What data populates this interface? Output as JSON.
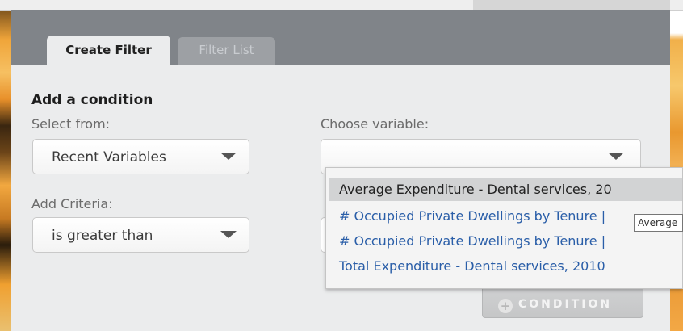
{
  "tabs": {
    "create_filter": "Create Filter",
    "filter_list": "Filter List"
  },
  "form": {
    "title": "Add a condition",
    "select_from_label": "Select from:",
    "select_from_value": "Recent Variables",
    "choose_variable_label": "Choose variable:",
    "choose_variable_value": "",
    "add_criteria_label": "Add Criteria:",
    "criteria_value": "is greater than",
    "condition_button": "CONDITION"
  },
  "suggestions": [
    {
      "label": "Average Expenditure - Dental services, 20",
      "selected": true
    },
    {
      "label": "# Occupied Private Dwellings by Tenure |",
      "selected": false
    },
    {
      "label": "# Occupied Private Dwellings by Tenure |",
      "selected": false
    },
    {
      "label": "Total Expenditure - Dental services, 2010",
      "selected": false
    }
  ],
  "tooltip": "Average",
  "icons": {
    "dropdown_arrow": "chevron-down-icon",
    "condition_button": "plus-circle-icon"
  },
  "colors": {
    "tab_strip": "#808489",
    "panel": "#ebeced",
    "link": "#2a5ea8",
    "selected_row": "#d2d3d4"
  }
}
